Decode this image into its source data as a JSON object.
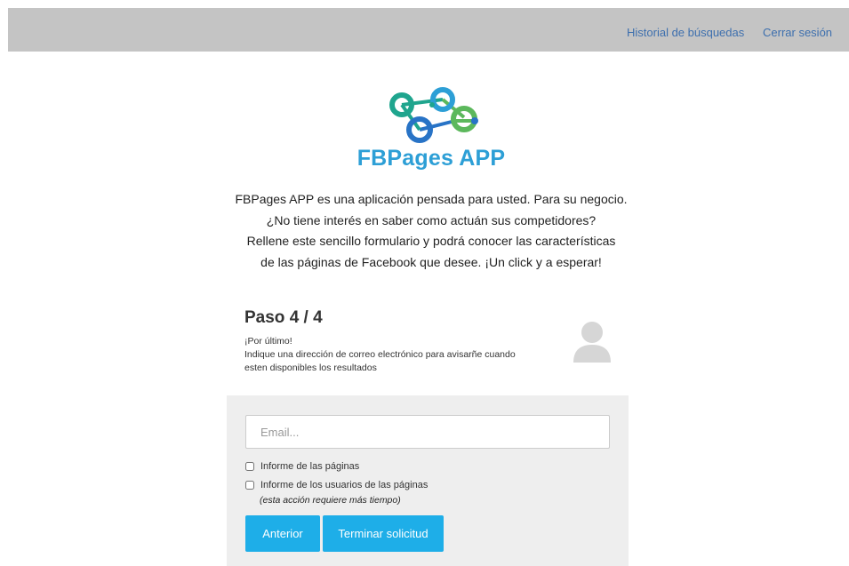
{
  "nav": {
    "history": "Historial de búsquedas",
    "logout": "Cerrar sesión"
  },
  "logo": {
    "text": "FBPages APP"
  },
  "intro": {
    "lines": [
      "FBPages APP es una aplicación pensada para usted. Para su negocio.",
      "¿No tiene interés en saber como actuán sus competidores?",
      "Rellene este sencillo formulario y podrá conocer las características",
      "de las páginas de Facebook que desee. ¡Un click y a esperar!"
    ]
  },
  "step": {
    "title": "Paso 4 / 4",
    "desc_lines": [
      "¡Por último!",
      "Indique una dirección de correo electrónico para avisarñe cuando",
      "esten disponibles los resultados"
    ],
    "icon": "user-avatar-icon"
  },
  "form": {
    "email_placeholder": "Email...",
    "email_value": "",
    "check_pages_label": "Informe de las páginas",
    "check_pages_checked": false,
    "check_users_label": "Informe de los usuarios de las páginas",
    "check_users_checked": false,
    "check_users_note": "(esta acción requiere más tiempo)",
    "prev_button": "Anterior",
    "finish_button": "Terminar solicitud"
  },
  "colors": {
    "topbar": "#c4c4c4",
    "nav_link": "#3d6fae",
    "logo_text": "#2d9fd6",
    "logo_teal": "#1fa58e",
    "logo_blue": "#2873c6",
    "logo_green": "#5cb85c",
    "button": "#1eaee8",
    "panel": "#eeeeee"
  }
}
